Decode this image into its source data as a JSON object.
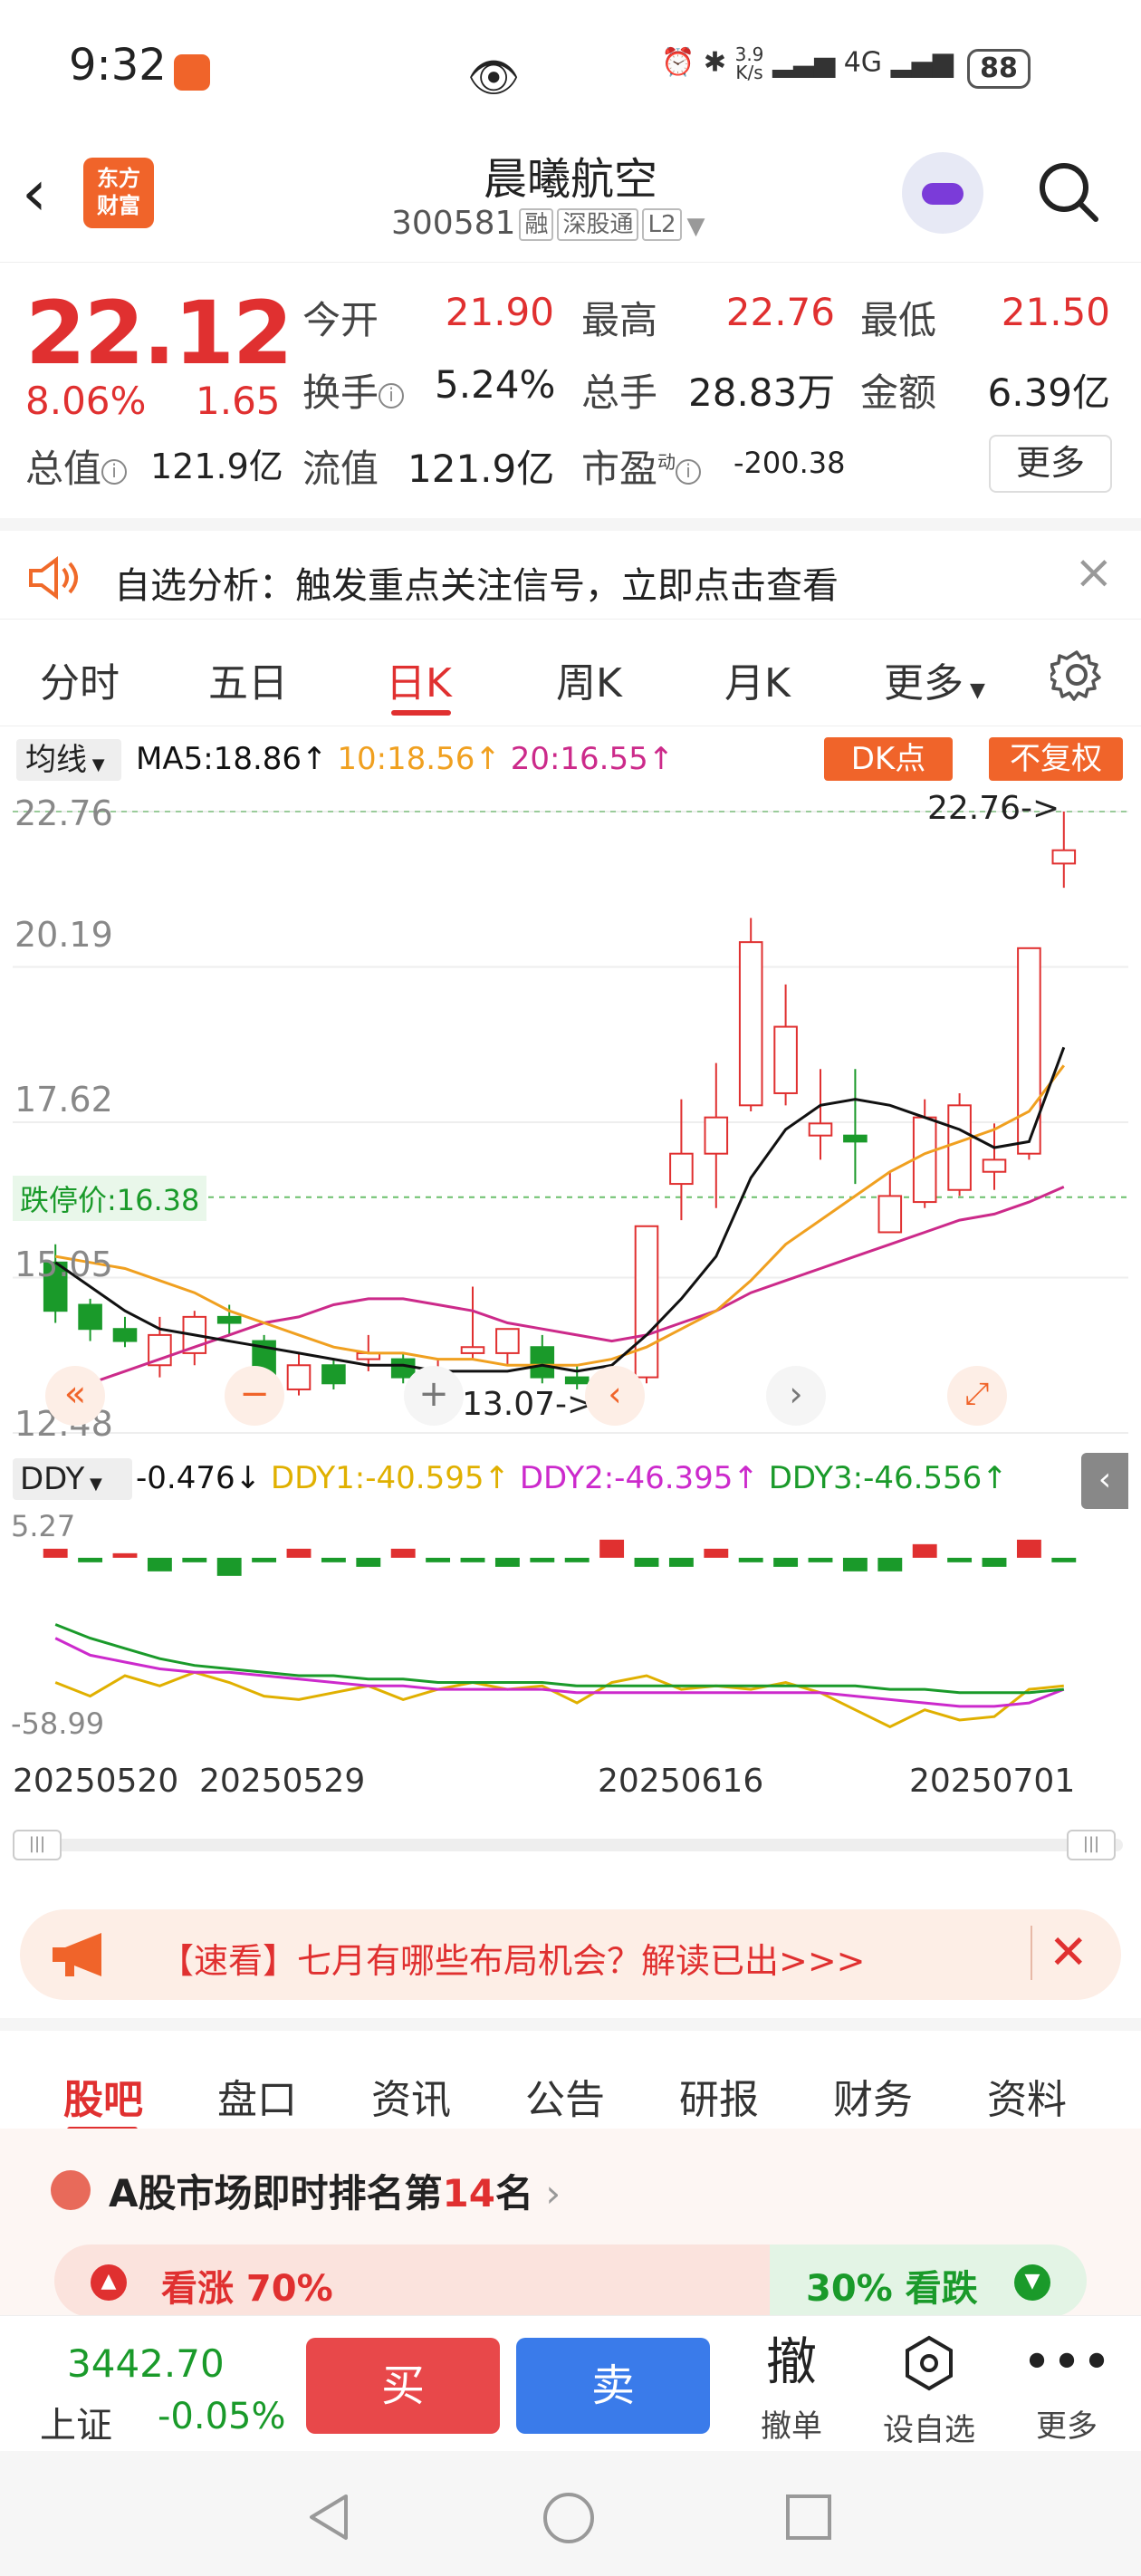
{
  "status": {
    "time": "9:32",
    "net": "3.9",
    "net_unit": "K/s",
    "signal": "4G",
    "battery": "88"
  },
  "header": {
    "logo_line1": "东方",
    "logo_line2": "财富",
    "title": "晨曦航空",
    "code": "300581",
    "tags": [
      "融",
      "深股通",
      "L2"
    ]
  },
  "quote": {
    "price": "22.12",
    "pct": "8.06%",
    "change": "1.65",
    "open_label": "今开",
    "open": "21.90",
    "high_label": "最高",
    "high": "22.76",
    "low_label": "最低",
    "low": "21.50",
    "turnover_label": "换手",
    "turnover": "5.24%",
    "volume_label": "总手",
    "volume": "28.83万",
    "amount_label": "金额",
    "amount": "6.39亿",
    "mcap_label": "总值",
    "mcap": "121.9亿",
    "float_label": "流值",
    "float": "121.9亿",
    "pe_label": "市盈",
    "pe_sup": "动",
    "pe": "-200.38",
    "more": "更多"
  },
  "alert": {
    "text": "自选分析：触发重点关注信号，立即点击查看"
  },
  "tabs": [
    "分时",
    "五日",
    "日K",
    "周K",
    "月K",
    "更多"
  ],
  "active_tab": "日K",
  "chart": {
    "ma_selector": "均线",
    "ma5": "MA5:18.86↑",
    "ma10": "10:18.56↑",
    "ma20": "20:16.55↑",
    "dk_button": "DK点",
    "adj_button": "不复权",
    "y_labels": [
      "22.76",
      "20.19",
      "17.62",
      "15.05",
      "12.48"
    ],
    "limit_down": "跌停价:16.38",
    "max_label": "22.76->",
    "min_label": "13.07->",
    "ind_selector": "DDY",
    "ddy": "-0.476↓",
    "ddy1": "DDY1:-40.595↑",
    "ddy2": "DDY2:-46.395↑",
    "ddy3": "DDY3:-46.556↑",
    "ind_top": "5.27",
    "ind_bottom": "-58.99",
    "dates": [
      "20250520",
      "20250529",
      "20250616",
      "20250701"
    ],
    "colors": {
      "up": "#e03030",
      "down": "#1a9a2a",
      "ma5": "#111111",
      "ma10": "#f0a020",
      "ma20": "#cc2a8a"
    }
  },
  "chart_data": {
    "type": "candlestick",
    "ylim": [
      12.48,
      22.76
    ],
    "candles": [
      {
        "o": 15.3,
        "h": 15.6,
        "c": 14.5,
        "l": 14.3
      },
      {
        "o": 14.6,
        "h": 14.7,
        "c": 14.2,
        "l": 14.0
      },
      {
        "o": 14.2,
        "h": 14.4,
        "c": 14.0,
        "l": 13.9
      },
      {
        "o": 13.6,
        "h": 14.4,
        "c": 14.1,
        "l": 13.4
      },
      {
        "o": 13.8,
        "h": 14.5,
        "c": 14.4,
        "l": 13.6
      },
      {
        "o": 14.4,
        "h": 14.6,
        "c": 14.3,
        "l": 14.1
      },
      {
        "o": 14.0,
        "h": 14.1,
        "c": 13.4,
        "l": 13.3
      },
      {
        "o": 13.2,
        "h": 13.8,
        "c": 13.6,
        "l": 13.1
      },
      {
        "o": 13.6,
        "h": 13.7,
        "c": 13.3,
        "l": 13.2
      },
      {
        "o": 13.7,
        "h": 14.1,
        "c": 13.8,
        "l": 13.5
      },
      {
        "o": 13.7,
        "h": 13.8,
        "c": 13.4,
        "l": 13.3
      },
      {
        "o": 13.1,
        "h": 13.7,
        "c": 13.4,
        "l": 13.0
      },
      {
        "o": 13.8,
        "h": 14.9,
        "c": 13.9,
        "l": 13.7
      },
      {
        "o": 13.8,
        "h": 14.1,
        "c": 14.2,
        "l": 13.6
      },
      {
        "o": 13.9,
        "h": 14.1,
        "c": 13.4,
        "l": 13.3
      },
      {
        "o": 13.4,
        "h": 13.6,
        "c": 13.3,
        "l": 13.2
      },
      {
        "o": 13.3,
        "h": 13.5,
        "c": 13.1,
        "l": 13.07
      },
      {
        "o": 13.4,
        "h": 15.9,
        "c": 15.9,
        "l": 13.3
      },
      {
        "o": 16.6,
        "h": 18.0,
        "c": 17.1,
        "l": 16.0
      },
      {
        "o": 17.1,
        "h": 18.6,
        "c": 17.7,
        "l": 16.2
      },
      {
        "o": 17.9,
        "h": 21.0,
        "c": 20.6,
        "l": 17.8
      },
      {
        "o": 18.1,
        "h": 19.9,
        "c": 19.2,
        "l": 17.9
      },
      {
        "o": 17.4,
        "h": 18.5,
        "c": 17.6,
        "l": 17.0
      },
      {
        "o": 17.4,
        "h": 18.5,
        "c": 17.3,
        "l": 16.6
      },
      {
        "o": 15.8,
        "h": 16.8,
        "c": 16.4,
        "l": 15.8
      },
      {
        "o": 16.3,
        "h": 18.0,
        "c": 17.7,
        "l": 16.2
      },
      {
        "o": 16.5,
        "h": 18.1,
        "c": 17.9,
        "l": 16.4
      },
      {
        "o": 16.8,
        "h": 17.6,
        "c": 17.0,
        "l": 16.5
      },
      {
        "o": 17.1,
        "h": 20.5,
        "c": 20.5,
        "l": 17.0
      },
      {
        "o": 21.9,
        "h": 22.76,
        "c": 22.12,
        "l": 21.5
      }
    ],
    "ma5": [
      15.3,
      14.9,
      14.5,
      14.2,
      14.1,
      14.0,
      13.9,
      13.8,
      13.7,
      13.6,
      13.6,
      13.5,
      13.5,
      13.5,
      13.6,
      13.5,
      13.6,
      14.1,
      14.7,
      15.4,
      16.7,
      17.5,
      17.9,
      18.0,
      17.9,
      17.7,
      17.5,
      17.2,
      17.3,
      18.86
    ],
    "ma10": [
      15.4,
      15.3,
      15.2,
      15.0,
      14.8,
      14.5,
      14.3,
      14.1,
      13.9,
      13.8,
      13.8,
      13.7,
      13.7,
      13.6,
      13.6,
      13.6,
      13.7,
      13.9,
      14.2,
      14.5,
      15.0,
      15.6,
      16.0,
      16.4,
      16.8,
      17.1,
      17.3,
      17.5,
      17.8,
      18.56
    ],
    "ma20": [
      13.1,
      13.3,
      13.5,
      13.7,
      13.9,
      14.1,
      14.3,
      14.4,
      14.6,
      14.7,
      14.7,
      14.6,
      14.5,
      14.3,
      14.2,
      14.1,
      14.0,
      14.1,
      14.3,
      14.5,
      14.8,
      15.0,
      15.2,
      15.4,
      15.6,
      15.8,
      16.0,
      16.1,
      16.3,
      16.55
    ],
    "ind_ylim": [
      -58.99,
      5.27
    ],
    "ind_bars": [
      2,
      -1,
      1,
      -3,
      -1,
      -4,
      -1,
      2,
      -1,
      -2,
      2,
      -1,
      -1,
      -2,
      -1,
      -1,
      4,
      -2,
      -2,
      2,
      -1,
      -2,
      -1,
      -3,
      -3,
      3,
      -1,
      -2,
      4,
      -1
    ],
    "ddy1": [
      -44,
      -48,
      -42,
      -45,
      -41,
      -44,
      -48,
      -49,
      -47,
      -45,
      -49,
      -46,
      -44,
      -46,
      -45,
      -50,
      -44,
      -42,
      -46,
      -45,
      -46,
      -44,
      -47,
      -52,
      -57,
      -52,
      -55,
      -54,
      -46,
      -45
    ],
    "ddy2": [
      -31,
      -36,
      -38,
      -40,
      -41,
      -41,
      -42,
      -43,
      -44,
      -45,
      -45,
      -46,
      -46,
      -46,
      -46,
      -47,
      -47,
      -47,
      -47,
      -47,
      -47,
      -47,
      -47,
      -48,
      -49,
      -50,
      -51,
      -51,
      -50,
      -46
    ],
    "ddy3": [
      -27,
      -31,
      -34,
      -37,
      -39,
      -40,
      -41,
      -42,
      -42,
      -43,
      -43,
      -44,
      -44,
      -44,
      -44,
      -45,
      -45,
      -45,
      -45,
      -45,
      -45,
      -45,
      -45,
      -45,
      -46,
      -46,
      -47,
      -47,
      -47,
      -46
    ]
  },
  "banner": {
    "text": "【速看】七月有哪些布局机会？解读已出>>>"
  },
  "bottom_tabs": [
    "股吧",
    "盘口",
    "资讯",
    "公告",
    "研报",
    "财务",
    "资料"
  ],
  "rank": {
    "text_prefix": "A股市场即时排名第",
    "rank": "14",
    "text_suffix": "名",
    "bull": "看涨 70%",
    "bear": "30% 看跌"
  },
  "index": {
    "value": "3442.70",
    "name": "上证",
    "pct": "-0.05%"
  },
  "actions": {
    "buy": "买",
    "sell": "卖",
    "cancel_icon": "撤",
    "cancel": "撤单",
    "watch": "设自选",
    "more": "更多"
  }
}
